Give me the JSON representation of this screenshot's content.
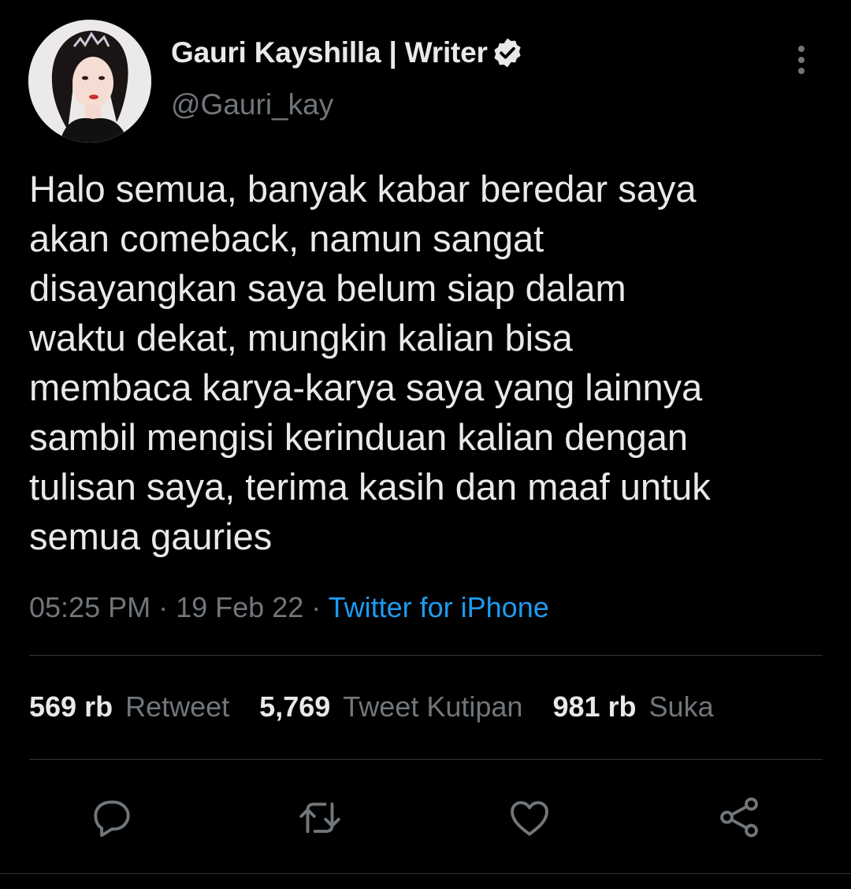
{
  "tweet": {
    "author": {
      "display_name": "Gauri Kayshilla | Writer",
      "handle": "@Gauri_kay",
      "avatar_icon": "profile-photo",
      "verified": true
    },
    "text": "Halo semua, banyak kabar beredar saya\nakan comeback, namun sangat\ndisayangkan saya belum siap dalam\nwaktu dekat, mungkin kalian bisa\nmembaca karya-karya saya yang lainnya\nsambil mengisi kerinduan kalian dengan\ntulisan saya, terima kasih dan maaf untuk\nsemua gauries",
    "time": "05:25 PM",
    "separator": "·",
    "date": "19 Feb 22",
    "source": "Twitter for iPhone",
    "stats": [
      {
        "value": "569 rb",
        "label": "Retweet"
      },
      {
        "value": "5,769",
        "label": "Tweet Kutipan"
      },
      {
        "value": "981 rb",
        "label": "Suka"
      }
    ],
    "actions": [
      "reply-icon",
      "retweet-icon",
      "like-icon",
      "share-icon"
    ]
  },
  "colors": {
    "background": "#000000",
    "text_primary": "#e7e9ea",
    "text_secondary": "#71767b",
    "accent": "#1d9bf0",
    "divider": "#2f3336"
  }
}
